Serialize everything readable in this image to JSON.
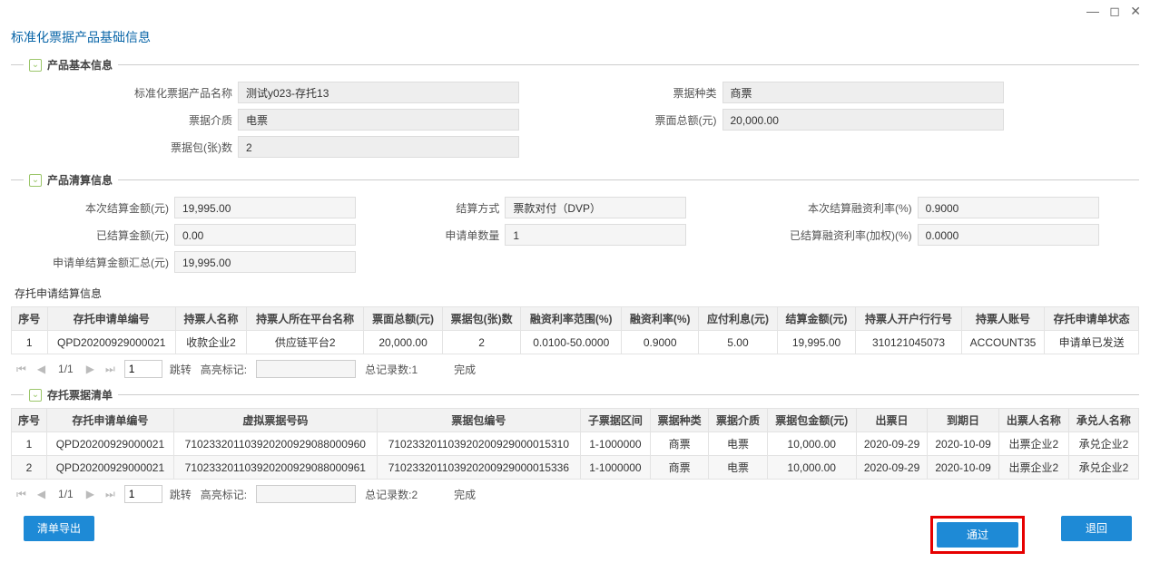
{
  "window": {
    "minimize": "—",
    "restore": "◻",
    "close": "✕"
  },
  "page_title": "标准化票据产品基础信息",
  "sections": {
    "basic": "产品基本信息",
    "settle": "产品清算信息",
    "trust_settle_heading": "存托申请结算信息",
    "trust_list": "存托票据清单"
  },
  "basic_form": {
    "name_label": "标准化票据产品名称",
    "name_value": "测试y023-存托13",
    "medium_label": "票据介质",
    "medium_value": "电票",
    "pkg_count_label": "票据包(张)数",
    "pkg_count_value": "2",
    "type_label": "票据种类",
    "type_value": "商票",
    "face_total_label": "票面总额(元)",
    "face_total_value": "20,000.00"
  },
  "settle_form": {
    "this_amt_label": "本次结算金额(元)",
    "this_amt_value": "19,995.00",
    "settled_amt_label": "已结算金额(元)",
    "settled_amt_value": "0.00",
    "req_sum_label": "申请单结算金额汇总(元)",
    "req_sum_value": "19,995.00",
    "method_label": "结算方式",
    "method_value": "票款对付（DVP）",
    "req_count_label": "申请单数量",
    "req_count_value": "1",
    "this_rate_label": "本次结算融资利率(%)",
    "this_rate_value": "0.9000",
    "weighted_rate_label": "已结算融资利率(加权)(%)",
    "weighted_rate_value": "0.0000"
  },
  "table1": {
    "headers": [
      "序号",
      "存托申请单编号",
      "持票人名称",
      "持票人所在平台名称",
      "票面总额(元)",
      "票据包(张)数",
      "融资利率范围(%)",
      "融资利率(%)",
      "应付利息(元)",
      "结算金额(元)",
      "持票人开户行行号",
      "持票人账号",
      "存托申请单状态"
    ],
    "rows": [
      [
        "1",
        "QPD20200929000021",
        "收款企业2",
        "供应链平台2",
        "20,000.00",
        "2",
        "0.0100-50.0000",
        "0.9000",
        "5.00",
        "19,995.00",
        "310121045073",
        "ACCOUNT35",
        "申请单已发送"
      ]
    ]
  },
  "table2": {
    "headers": [
      "序号",
      "存托申请单编号",
      "虚拟票据号码",
      "票据包编号",
      "子票据区间",
      "票据种类",
      "票据介质",
      "票据包金额(元)",
      "出票日",
      "到期日",
      "出票人名称",
      "承兑人名称"
    ],
    "rows": [
      [
        "1",
        "QPD20200929000021",
        "710233201103920200929088000960",
        "710233201103920200929000015310",
        "1-1000000",
        "商票",
        "电票",
        "10,000.00",
        "2020-09-29",
        "2020-10-09",
        "出票企业2",
        "承兑企业2"
      ],
      [
        "2",
        "QPD20200929000021",
        "710233201103920200929088000961",
        "710233201103920200929000015336",
        "1-1000000",
        "商票",
        "电票",
        "10,000.00",
        "2020-09-29",
        "2020-10-09",
        "出票企业2",
        "承兑企业2"
      ]
    ]
  },
  "pager1": {
    "page_text": "1/1",
    "page_input": "1",
    "jump_label": "跳转",
    "hl_label": "高亮标记:",
    "total_label": "总记录数:1",
    "done_label": "完成"
  },
  "pager2": {
    "page_text": "1/1",
    "page_input": "1",
    "jump_label": "跳转",
    "hl_label": "高亮标记:",
    "total_label": "总记录数:2",
    "done_label": "完成"
  },
  "buttons": {
    "export": "清单导出",
    "pass": "通过",
    "back": "退回"
  }
}
